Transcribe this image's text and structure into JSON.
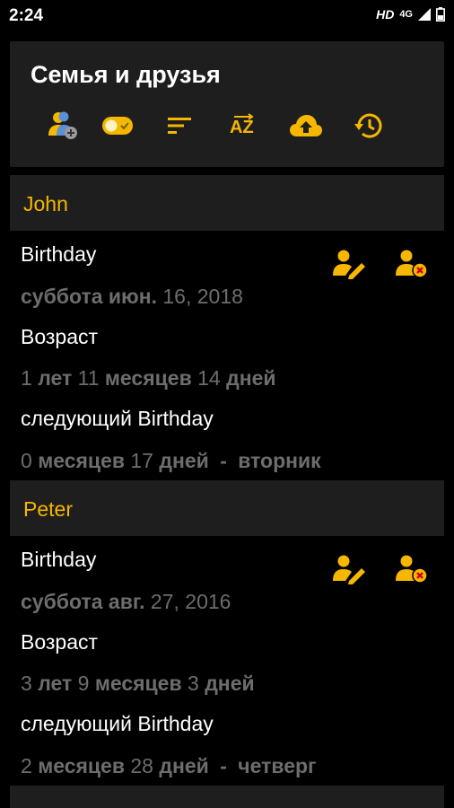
{
  "status": {
    "time": "2:24",
    "hd": "HD",
    "network": "4G"
  },
  "header": {
    "title": "Семья и друзья",
    "tools": [
      "add-contact-icon",
      "toggle-icon",
      "sort-icon",
      "sort-az-icon",
      "cloud-upload-icon",
      "history-icon"
    ]
  },
  "colors": {
    "accent": "#f5b700",
    "card": "#1e1e1e",
    "muted": "#6d6d6d"
  },
  "entries": [
    {
      "name": "John",
      "birthday_label": "Birthday",
      "date": {
        "weekday": "суббота",
        "month": "июн.",
        "rest": "16, 2018"
      },
      "age_label": "Возраст",
      "age": {
        "years": "1",
        "years_w": "лет",
        "months": "11",
        "months_w": "месяцев",
        "days": "14",
        "days_w": "дней"
      },
      "next_label": "следующий Birthday",
      "next": {
        "months": "0",
        "months_w": "месяцев",
        "days": "17",
        "days_w": "дней",
        "sep": "-",
        "weekday": "вторник"
      }
    },
    {
      "name": "Peter",
      "birthday_label": "Birthday",
      "date": {
        "weekday": "суббота",
        "month": "авг.",
        "rest": "27, 2016"
      },
      "age_label": "Возраст",
      "age": {
        "years": "3",
        "years_w": "лет",
        "months": "9",
        "months_w": "месяцев",
        "days": "3",
        "days_w": "дней"
      },
      "next_label": "следующий Birthday",
      "next": {
        "months": "2",
        "months_w": "месяцев",
        "days": "28",
        "days_w": "дней",
        "sep": "-",
        "weekday": "четверг"
      }
    }
  ]
}
